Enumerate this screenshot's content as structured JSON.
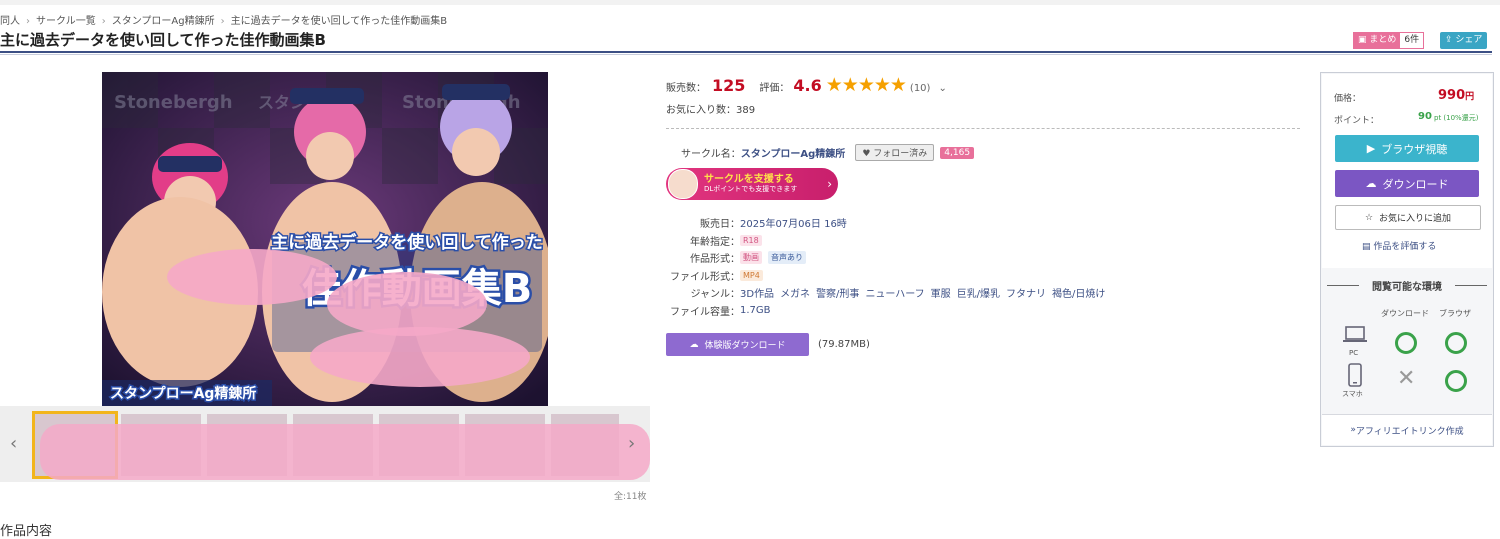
{
  "breadcrumb": [
    "同人",
    "サークル一覧",
    "スタンプローAg精錬所",
    "主に過去データを使い回して作った佳作動画集B"
  ],
  "title": "主に過去データを使い回して作った佳作動画集B",
  "header_actions": {
    "matome_label": "まとめ",
    "matome_count": "6件",
    "share_label": "シェア"
  },
  "gallery": {
    "image_title_top": "主に過去データを使い回して作った",
    "image_title_main": "佳作動画集B",
    "image_circle": "スタンプローAg精錬所",
    "image_watermark": "Stonebergh",
    "image_logo_text": "スタンプロー",
    "count": "全:11枚"
  },
  "section_heading": "作品内容",
  "stats": {
    "sales_label": "販売数：",
    "sales_value": "125",
    "rating_label": "評価：",
    "rating_value": "4.6",
    "rating_stars": 4.6,
    "rating_count": "(10)",
    "favorites": "お気に入り数：389"
  },
  "circle": {
    "label": "サークル名：",
    "name": "スタンプローAg精錬所",
    "follow_label": "フォロー済み",
    "follower_count": "4,165",
    "support_title": "サークルを支援する",
    "support_sub": "DLポイントでも支援できます"
  },
  "specs": {
    "release_label": "販売日：",
    "release_value": "2025年07月06日 16時",
    "age_label": "年齢指定：",
    "age_value": "R18",
    "format_label": "作品形式：",
    "format_tags": [
      "動画",
      "音声あり"
    ],
    "filetype_label": "ファイル形式：",
    "filetype_value": "MP4",
    "genre_label": "ジャンル：",
    "genres": [
      "3D作品",
      "メガネ",
      "警察/刑事",
      "ニューハーフ",
      "軍服",
      "巨乳/爆乳",
      "フタナリ",
      "褐色/日焼け"
    ],
    "size_label": "ファイル容量：",
    "size_value": "1.7GB"
  },
  "trial": {
    "label": "体験版ダウンロード",
    "size": "(79.87MB)"
  },
  "purchase": {
    "price_label": "価格：",
    "price_value": "990",
    "price_unit": "円",
    "point_label": "ポイント：",
    "point_value": "90",
    "point_note": "pt (10%還元)",
    "browser_button": "ブラウザ視聴",
    "download_button": "ダウンロード",
    "favorite_button": "お気に入りに追加",
    "rate_link": "作品を評価する",
    "env_heading": "閲覧可能な環境",
    "env_cols": [
      "ダウンロード",
      "ブラウザ"
    ],
    "env_rows": [
      {
        "device": "PC",
        "download": "○",
        "browser": "○"
      },
      {
        "device": "スマホ",
        "download": "×",
        "browser": "○"
      }
    ],
    "affiliate_link": "アフィリエイトリンク作成"
  },
  "colors": {
    "accent_navy": "#3c4f84",
    "price_red": "#c30d23",
    "teal": "#3bb4cc",
    "purple": "#7b56c3",
    "pink": "#e8709a"
  }
}
